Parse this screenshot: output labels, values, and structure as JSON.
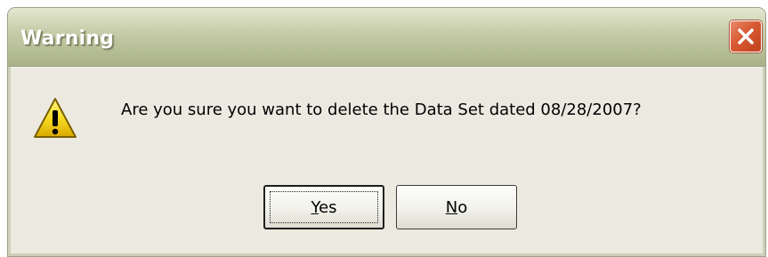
{
  "dialog": {
    "title": "Warning",
    "message": "Are you sure you want to delete the Data Set dated 08/28/2007?",
    "icon": "warning-icon",
    "buttons": {
      "yes": {
        "accel": "Y",
        "rest": "es"
      },
      "no": {
        "accel": "N",
        "rest": "o"
      }
    },
    "close_icon": "close-icon"
  },
  "colors": {
    "titlebar": "#b5bd95",
    "background": "#eceae0",
    "close_button": "#d85a32",
    "warning_yellow": "#f5d820"
  }
}
